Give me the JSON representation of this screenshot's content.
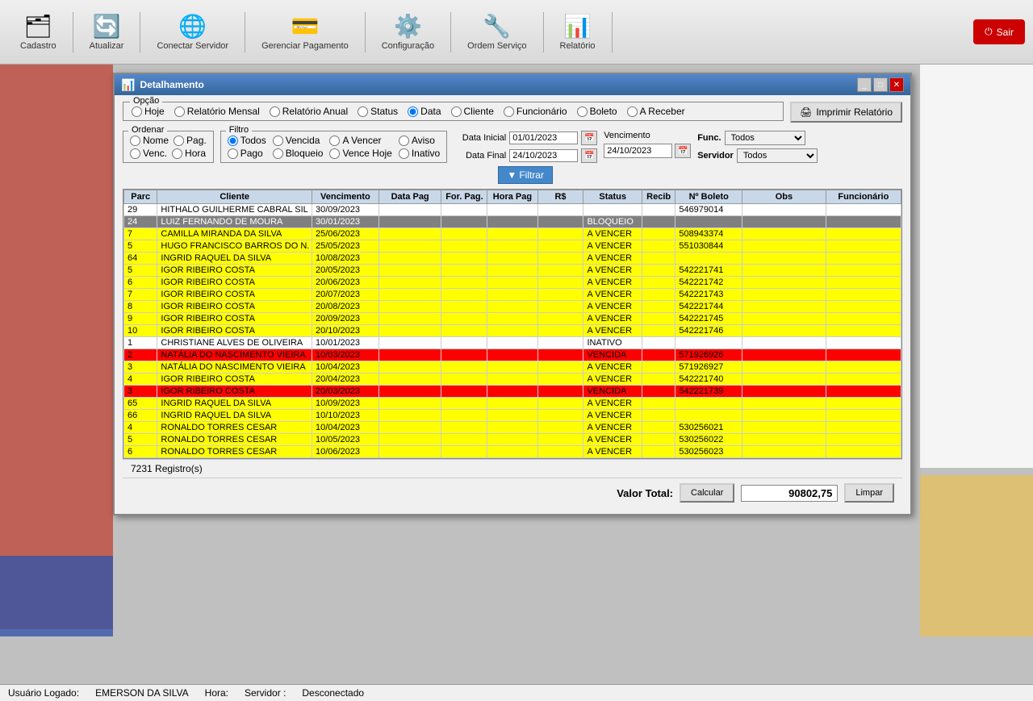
{
  "toolbar": {
    "items": [
      {
        "label": "Cadastro",
        "icon": "🗂"
      },
      {
        "label": "Atualizar",
        "icon": "🔄"
      },
      {
        "label": "Conectar Servidor",
        "icon": "🌐"
      },
      {
        "label": "Gerenciar Pagamento",
        "icon": "💳"
      },
      {
        "label": "Configuração",
        "icon": "⚙️"
      },
      {
        "label": "Ordem Serviço",
        "icon": "🔧"
      },
      {
        "label": "Relatório",
        "icon": "📊"
      }
    ],
    "sair": "Sair"
  },
  "modal": {
    "title": "Detalhamento",
    "imprimir": "Imprimir Relatório"
  },
  "opcao": {
    "label": "Opção",
    "items": [
      "Hoje",
      "Relatório Mensal",
      "Relatório Anual",
      "Status",
      "Data",
      "Cliente",
      "Funcionário",
      "Boleto",
      "A Receber"
    ],
    "selected": "Data"
  },
  "ordenar": {
    "label": "Ordenar",
    "items": [
      "Nome",
      "Pag.",
      "Venc.",
      "Hora"
    ]
  },
  "filtro": {
    "label": "Filtro",
    "items": [
      "Todos",
      "Vencida",
      "A Vencer",
      "Aviso",
      "Pago",
      "Bloqueio",
      "Vence Hoje",
      "Inativo"
    ],
    "selected": "Todos"
  },
  "data": {
    "inicial_label": "Data Inicial",
    "final_label": "Data Final",
    "inicial": "01/01/2023",
    "final": "24/10/2023",
    "filtrar": "Filtrar"
  },
  "vencimento": {
    "label": "Vencimento",
    "value": "24/10/2023"
  },
  "func": {
    "label": "Func.",
    "options": [
      "Todos"
    ],
    "selected": "Todos",
    "servidor_label": "Servidor",
    "servidor_options": [
      "Todos"
    ],
    "servidor_selected": "Todos"
  },
  "table": {
    "headers": [
      "Parc",
      "Cliente",
      "Vencimento",
      "Data Pag",
      "For. Pag.",
      "Hora Pag",
      "R$",
      "Status",
      "Recib",
      "Nº Boleto",
      "Obs",
      "Funcionário"
    ],
    "rows": [
      {
        "parc": "29",
        "cliente": "HITHALO GUILHERME CABRAL SIL",
        "venc": "30/09/2023",
        "datapag": "",
        "forpag": "",
        "hora": "",
        "rs": "",
        "status": "",
        "recib": "",
        "boleto": "546979014",
        "obs": "",
        "func": "",
        "color": "white"
      },
      {
        "parc": "24",
        "cliente": "LUIZ FERNANDO DE MOURA",
        "venc": "30/01/2023",
        "datapag": "",
        "forpag": "",
        "hora": "",
        "rs": "",
        "status": "BLOQUEIO",
        "recib": "",
        "boleto": "",
        "obs": "",
        "func": "",
        "color": "gray"
      },
      {
        "parc": "7",
        "cliente": "CAMILLA MIRANDA DA SILVA",
        "venc": "25/06/2023",
        "datapag": "",
        "forpag": "",
        "hora": "",
        "rs": "",
        "status": "A VENCER",
        "recib": "",
        "boleto": "508943374",
        "obs": "",
        "func": "",
        "color": "yellow"
      },
      {
        "parc": "5",
        "cliente": "HUGO FRANCISCO BARROS DO N.",
        "venc": "25/05/2023",
        "datapag": "",
        "forpag": "",
        "hora": "",
        "rs": "",
        "status": "A VENCER",
        "recib": "",
        "boleto": "551030844",
        "obs": "",
        "func": "",
        "color": "yellow"
      },
      {
        "parc": "64",
        "cliente": "INGRID RAQUEL DA SILVA",
        "venc": "10/08/2023",
        "datapag": "",
        "forpag": "",
        "hora": "",
        "rs": "",
        "status": "A VENCER",
        "recib": "",
        "boleto": "",
        "obs": "",
        "func": "",
        "color": "yellow"
      },
      {
        "parc": "5",
        "cliente": "IGOR RIBEIRO COSTA",
        "venc": "20/05/2023",
        "datapag": "",
        "forpag": "",
        "hora": "",
        "rs": "",
        "status": "A VENCER",
        "recib": "",
        "boleto": "542221741",
        "obs": "",
        "func": "",
        "color": "yellow"
      },
      {
        "parc": "6",
        "cliente": "IGOR RIBEIRO COSTA",
        "venc": "20/06/2023",
        "datapag": "",
        "forpag": "",
        "hora": "",
        "rs": "",
        "status": "A VENCER",
        "recib": "",
        "boleto": "542221742",
        "obs": "",
        "func": "",
        "color": "yellow"
      },
      {
        "parc": "7",
        "cliente": "IGOR RIBEIRO COSTA",
        "venc": "20/07/2023",
        "datapag": "",
        "forpag": "",
        "hora": "",
        "rs": "",
        "status": "A VENCER",
        "recib": "",
        "boleto": "542221743",
        "obs": "",
        "func": "",
        "color": "yellow"
      },
      {
        "parc": "8",
        "cliente": "IGOR RIBEIRO COSTA",
        "venc": "20/08/2023",
        "datapag": "",
        "forpag": "",
        "hora": "",
        "rs": "",
        "status": "A VENCER",
        "recib": "",
        "boleto": "542221744",
        "obs": "",
        "func": "",
        "color": "yellow"
      },
      {
        "parc": "9",
        "cliente": "IGOR RIBEIRO COSTA",
        "venc": "20/09/2023",
        "datapag": "",
        "forpag": "",
        "hora": "",
        "rs": "",
        "status": "A VENCER",
        "recib": "",
        "boleto": "542221745",
        "obs": "",
        "func": "",
        "color": "yellow"
      },
      {
        "parc": "10",
        "cliente": "IGOR RIBEIRO COSTA",
        "venc": "20/10/2023",
        "datapag": "",
        "forpag": "",
        "hora": "",
        "rs": "",
        "status": "A VENCER",
        "recib": "",
        "boleto": "542221746",
        "obs": "",
        "func": "",
        "color": "yellow"
      },
      {
        "parc": "1",
        "cliente": "CHRISTIANE ALVES DE OLIVEIRA",
        "venc": "10/01/2023",
        "datapag": "",
        "forpag": "",
        "hora": "",
        "rs": "",
        "status": "INATIVO",
        "recib": "",
        "boleto": "",
        "obs": "",
        "func": "",
        "color": "white"
      },
      {
        "parc": "2",
        "cliente": "NATÁLIA DO NASCIMENTO VIEIRA",
        "venc": "10/03/2023",
        "datapag": "",
        "forpag": "",
        "hora": "",
        "rs": "",
        "status": "VENCIDA",
        "recib": "",
        "boleto": "571926926",
        "obs": "",
        "func": "",
        "color": "red"
      },
      {
        "parc": "3",
        "cliente": "NATÁLIA DO NASCIMENTO VIEIRA",
        "venc": "10/04/2023",
        "datapag": "",
        "forpag": "",
        "hora": "",
        "rs": "",
        "status": "A VENCER",
        "recib": "",
        "boleto": "571926927",
        "obs": "",
        "func": "",
        "color": "yellow"
      },
      {
        "parc": "4",
        "cliente": "IGOR RIBEIRO COSTA",
        "venc": "20/04/2023",
        "datapag": "",
        "forpag": "",
        "hora": "",
        "rs": "",
        "status": "A VENCER",
        "recib": "",
        "boleto": "542221740",
        "obs": "",
        "func": "",
        "color": "yellow"
      },
      {
        "parc": "3",
        "cliente": "IGOR RIBEIRO COSTA",
        "venc": "20/03/2023",
        "datapag": "",
        "forpag": "",
        "hora": "",
        "rs": "",
        "status": "VENCIDA",
        "recib": "",
        "boleto": "542221739",
        "obs": "",
        "func": "",
        "color": "red"
      },
      {
        "parc": "65",
        "cliente": "INGRID RAQUEL DA SILVA",
        "venc": "10/09/2023",
        "datapag": "",
        "forpag": "",
        "hora": "",
        "rs": "",
        "status": "A VENCER",
        "recib": "",
        "boleto": "",
        "obs": "",
        "func": "",
        "color": "yellow"
      },
      {
        "parc": "66",
        "cliente": "INGRID RAQUEL DA SILVA",
        "venc": "10/10/2023",
        "datapag": "",
        "forpag": "",
        "hora": "",
        "rs": "",
        "status": "A VENCER",
        "recib": "",
        "boleto": "",
        "obs": "",
        "func": "",
        "color": "yellow"
      },
      {
        "parc": "4",
        "cliente": "RONALDO TORRES CESAR",
        "venc": "10/04/2023",
        "datapag": "",
        "forpag": "",
        "hora": "",
        "rs": "",
        "status": "A VENCER",
        "recib": "",
        "boleto": "530256021",
        "obs": "",
        "func": "",
        "color": "yellow"
      },
      {
        "parc": "5",
        "cliente": "RONALDO TORRES CESAR",
        "venc": "10/05/2023",
        "datapag": "",
        "forpag": "",
        "hora": "",
        "rs": "",
        "status": "A VENCER",
        "recib": "",
        "boleto": "530256022",
        "obs": "",
        "func": "",
        "color": "yellow"
      },
      {
        "parc": "6",
        "cliente": "RONALDO TORRES CESAR",
        "venc": "10/06/2023",
        "datapag": "",
        "forpag": "",
        "hora": "",
        "rs": "",
        "status": "A VENCER",
        "recib": "",
        "boleto": "530256023",
        "obs": "",
        "func": "",
        "color": "yellow"
      }
    ]
  },
  "bottom": {
    "valor_total": "Valor Total:",
    "calcular": "Calcular",
    "total_value": "90802,75",
    "limpar": "Limpar"
  },
  "statusbar": {
    "usuario_label": "Usuário Logado:",
    "usuario": "EMERSON DA SILVA",
    "hora_label": "Hora:",
    "servidor_label": "Servidor :",
    "servidor": "Desconectado"
  },
  "reg_count": "7231 Registro(s)"
}
